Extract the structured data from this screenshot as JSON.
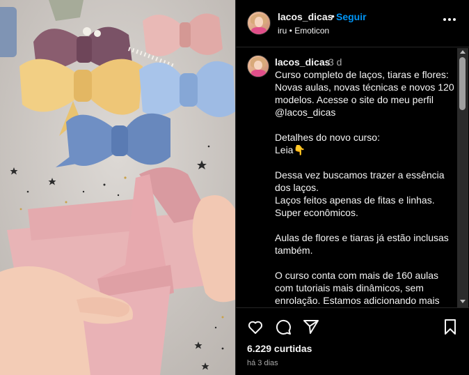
{
  "media": {
    "alt": ""
  },
  "header": {
    "username": "lacos_dicas",
    "separator": "•",
    "follow_label": "Seguir",
    "subtitle": "iru • Emoticon"
  },
  "post": {
    "username": "lacos_dicas",
    "time": "3 d",
    "caption": "Curso completo de laços, tiaras e flores: Novas aulas, novas técnicas e novos 120 modelos. Acesse o site do meu perfil @lacos_dicas\n\nDetalhes do novo curso:\nLeia👇\n\nDessa vez buscamos trazer a essência dos laços.\nLaços feitos apenas de fitas e linhas.\nSuper econômicos.\n\nAulas de flores e tiaras já estão inclusas também.\n\nO curso conta com mais de 160 aulas com tutoriais mais dinâmicos, sem enrolação. Estamos adicionando mais"
  },
  "actions": {
    "likes": "6.229 curtidas",
    "posted_ago": "há 3 dias"
  },
  "colors": {
    "follow": "#0095f6",
    "background": "#000000",
    "muted": "#a8a8a8"
  }
}
